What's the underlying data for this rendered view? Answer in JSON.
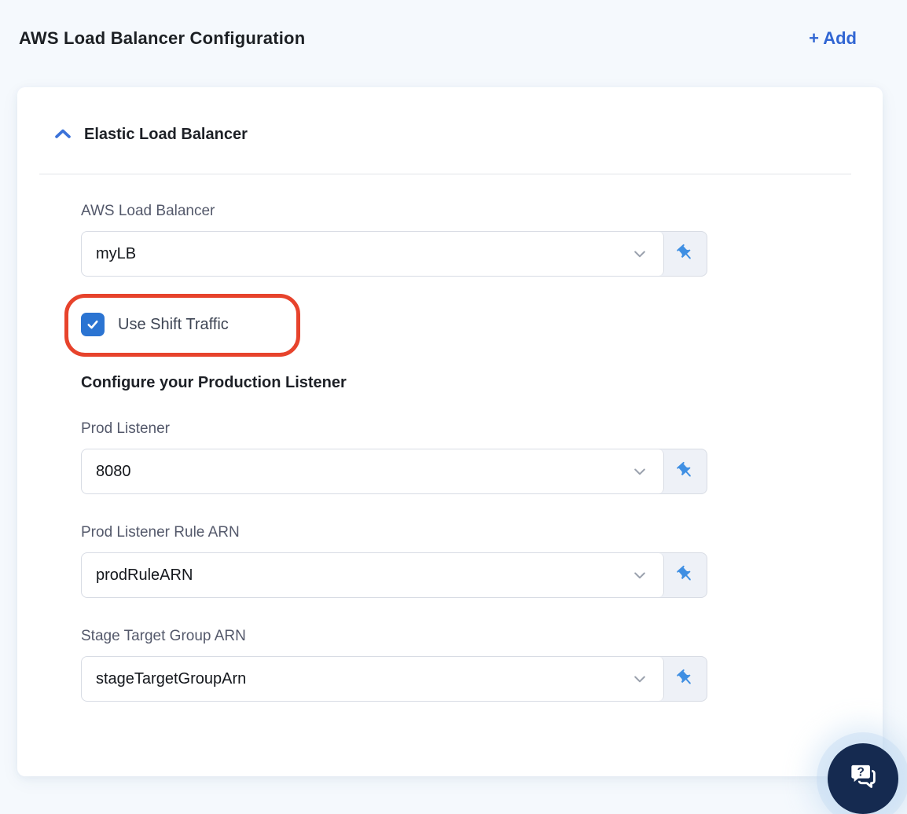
{
  "page": {
    "title": "AWS Load Balancer Configuration",
    "add_button_label": "+ Add"
  },
  "panel": {
    "section_title": "Elastic Load Balancer",
    "section_expanded": true,
    "fields": [
      {
        "label": "AWS Load Balancer",
        "value": "myLB"
      },
      {
        "label": "Prod Listener",
        "value": "8080"
      },
      {
        "label": "Prod Listener Rule ARN",
        "value": "prodRuleARN"
      },
      {
        "label": "Stage Target Group ARN",
        "value": "stageTargetGroupArn"
      }
    ],
    "checkbox": {
      "label": "Use Shift Traffic",
      "checked": true
    },
    "sub_heading": "Configure your Production Listener"
  },
  "annotation": {
    "shape": "rounded-rect-outline",
    "color": "#e7432c"
  },
  "icons": {
    "section_toggle": "chevron-up-icon",
    "dropdown": "chevron-down-icon",
    "pin": "pushpin-icon",
    "fab": "chat-help-icon"
  },
  "colors": {
    "accent_blue": "#3166d3",
    "pin_blue": "#3f8fe3",
    "checkbox_blue": "#2b74d2",
    "annotation_red": "#e7432c",
    "fab_navy": "#152a50",
    "page_bg": "#f5f9fd"
  }
}
